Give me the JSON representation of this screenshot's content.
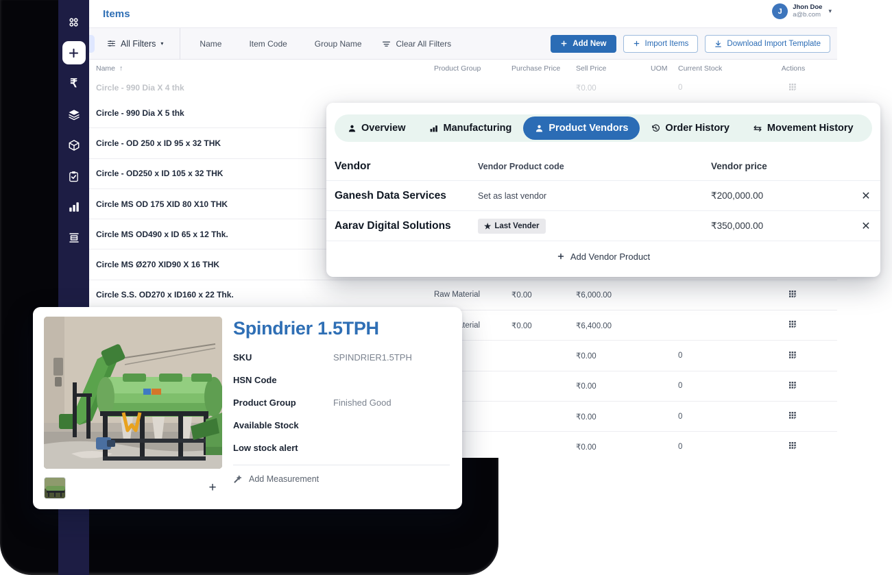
{
  "app": {
    "page_title": "Items",
    "user": {
      "initial": "J",
      "name": "Jhon Doe",
      "email": "a@b.com",
      "caret": "▾"
    }
  },
  "rail": {
    "items": [
      {
        "icon": "apps-grid-icon",
        "label": "Apps"
      },
      {
        "icon": "plus-icon",
        "label": "Create",
        "active": true
      },
      {
        "icon": "rupee-icon",
        "label": "Finance"
      },
      {
        "icon": "layers-icon",
        "label": "Layers"
      },
      {
        "icon": "cube-icon",
        "label": "Inventory"
      },
      {
        "icon": "clipboard-check-icon",
        "label": "Tasks"
      },
      {
        "icon": "bar-chart-icon",
        "label": "Reports"
      },
      {
        "icon": "table-icon",
        "label": "Data"
      }
    ]
  },
  "toolbar": {
    "search_icon": "search-icon",
    "all_filters": "All Filters",
    "all_filters_caret": "▾",
    "quick_filters": [
      "Name",
      "Item Code",
      "Group Name"
    ],
    "clear_all_filters": "Clear All Filters",
    "add_new": "Add New",
    "import_items": "Import Items",
    "download_template": "Download Import Template"
  },
  "table": {
    "headers": {
      "name": "Name",
      "sort_arrow": "↑",
      "product_group": "Product Group",
      "purchase_price": "Purchase Price",
      "sell_price": "Sell Price",
      "uom": "UOM",
      "current_stock": "Current Stock",
      "actions": "Actions"
    },
    "rows": [
      {
        "name": "Circle - 990 Dia X 4 thk",
        "group": "",
        "purchase_price": "",
        "sell_price": "₹0.00",
        "uom": "",
        "stock": "0",
        "faded": true
      },
      {
        "name": "Circle - 990 Dia X 5 thk",
        "group": "",
        "purchase_price": "",
        "sell_price": "",
        "uom": "",
        "stock": ""
      },
      {
        "name": "Circle - OD 250 x ID 95 x 32 THK",
        "group": "",
        "purchase_price": "",
        "sell_price": "",
        "uom": "",
        "stock": ""
      },
      {
        "name": "Circle - OD250 x ID 105 x 32 THK",
        "group": "",
        "purchase_price": "",
        "sell_price": "",
        "uom": "",
        "stock": ""
      },
      {
        "name": "Circle MS OD 175 XID 80 X10 THK",
        "group": "",
        "purchase_price": "",
        "sell_price": "",
        "uom": "",
        "stock": ""
      },
      {
        "name": "Circle MS OD490 x ID 65 x 12 Thk.",
        "group": "",
        "purchase_price": "",
        "sell_price": "",
        "uom": "",
        "stock": ""
      },
      {
        "name": "Circle MS Ø270 XID90 X 16 THK",
        "group": "",
        "purchase_price": "",
        "sell_price": "",
        "uom": "",
        "stock": ""
      },
      {
        "name": "Circle S.S. OD270 x ID160 x 22 Thk.",
        "group": "Raw Material",
        "purchase_price": "₹0.00",
        "sell_price": "₹6,000.00",
        "uom": "",
        "stock": ""
      },
      {
        "name": "",
        "group": "Raw Material",
        "purchase_price": "₹0.00",
        "sell_price": "₹6,400.00",
        "uom": "",
        "stock": ""
      },
      {
        "name": "",
        "group": "",
        "purchase_price": "",
        "sell_price": "₹0.00",
        "uom": "",
        "stock": "0"
      },
      {
        "name": "",
        "group": "",
        "purchase_price": "",
        "sell_price": "₹0.00",
        "uom": "",
        "stock": "0"
      },
      {
        "name": "",
        "group": "",
        "purchase_price": "",
        "sell_price": "₹0.00",
        "uom": "",
        "stock": "0"
      },
      {
        "name": "",
        "group": "",
        "purchase_price": "",
        "sell_price": "₹0.00",
        "uom": "",
        "stock": "0"
      }
    ]
  },
  "vendor_modal": {
    "tabs": [
      {
        "label": "Overview",
        "icon": "user-icon",
        "active": false
      },
      {
        "label": "Manufacturing",
        "icon": "factory-icon",
        "active": false
      },
      {
        "label": "Product Vendors",
        "icon": "user-icon",
        "active": true
      },
      {
        "label": "Order History",
        "icon": "history-icon",
        "active": false
      },
      {
        "label": "Movement History",
        "icon": "exchange-icon",
        "active": false
      }
    ],
    "headers": {
      "vendor": "Vendor",
      "code": "Vendor Product code",
      "price": "Vendor price"
    },
    "rows": [
      {
        "vendor": "Ganesh Data Services",
        "code": "Set as last vendor",
        "is_badge": false,
        "price": "₹200,000.00",
        "remove": "✕"
      },
      {
        "vendor": "Aarav Digital Solutions",
        "code": "Last Vender",
        "is_badge": true,
        "price": "₹350,000.00",
        "remove": "✕"
      }
    ],
    "add_vendor_product": "Add Vendor Product",
    "add_icon": "plus-icon",
    "star_icon": "★"
  },
  "product_card": {
    "title": "Spindrier 1.5TPH",
    "specs": [
      {
        "key": "SKU",
        "value": "SPINDRIER1.5TPH"
      },
      {
        "key": "HSN Code",
        "value": ""
      },
      {
        "key": "Product Group",
        "value": "Finished Good"
      },
      {
        "key": "Available Stock",
        "value": ""
      },
      {
        "key": "Low stock alert",
        "value": ""
      }
    ],
    "add_measurement": "Add Measurement",
    "add_image_plus": "+",
    "image_alt": "spindrier-machine-photo"
  },
  "colors": {
    "accent_blue": "#2b6cb5",
    "rail_navy": "#1d1d44",
    "tabstrip_mint": "#e9f4f0",
    "toolbar_gray": "#f7f7fa"
  }
}
